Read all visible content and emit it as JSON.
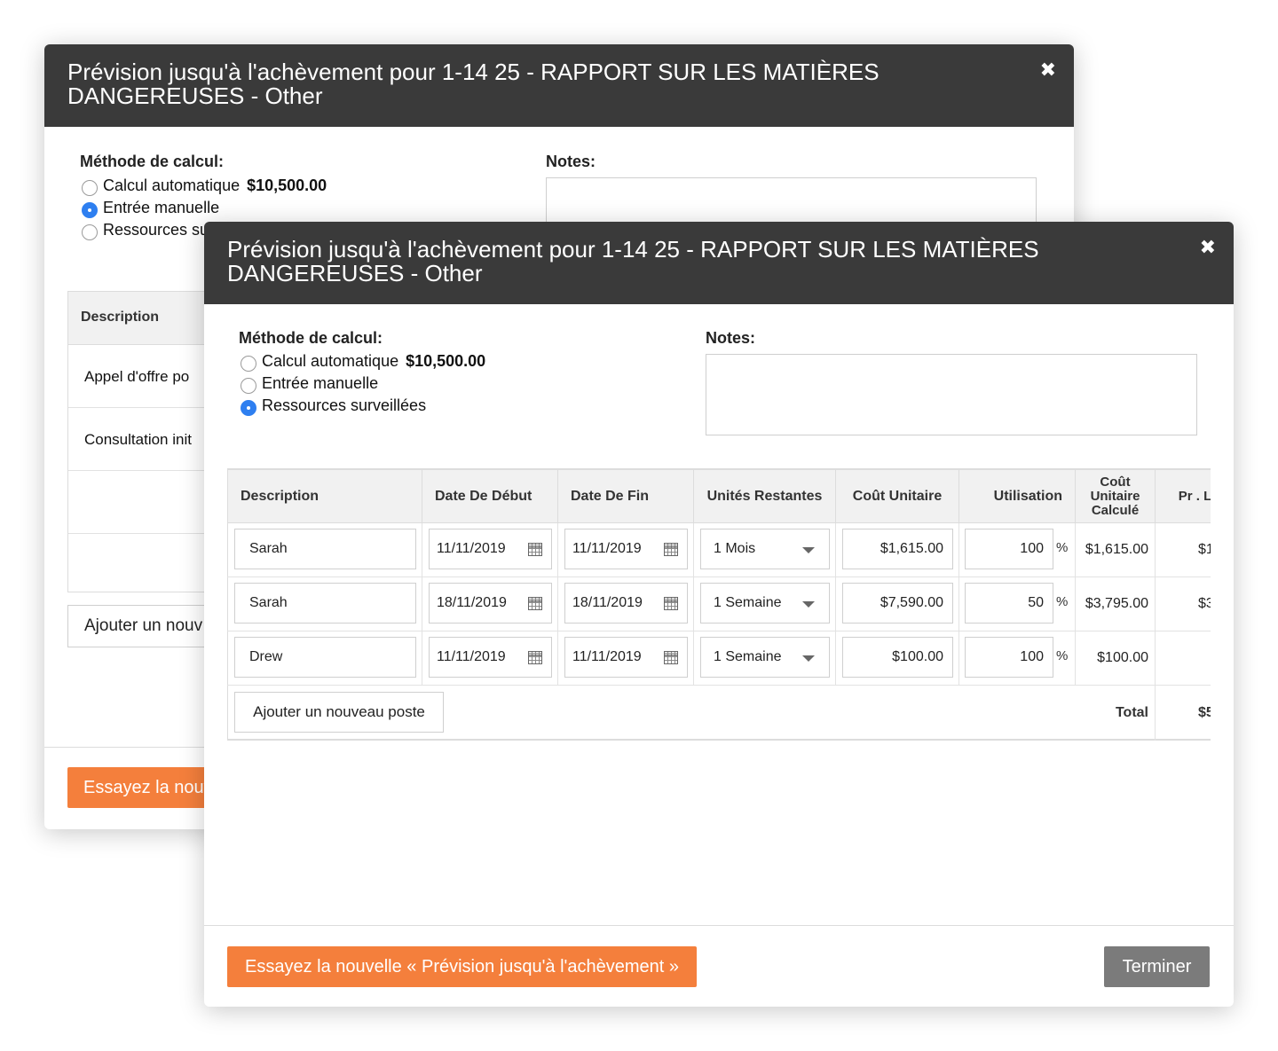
{
  "dialog": {
    "title": "Prévision jusqu'à l'achèvement pour 1-14 25 - RAPPORT SUR LES MATIÈRES DANGEREUSES - Other",
    "close_glyph": "✖",
    "method_label": "Méthode de calcul:",
    "notes_label": "Notes:",
    "options": {
      "auto": "Calcul automatique",
      "auto_amount": "$10,500.00",
      "manual": "Entrée manuelle",
      "tracked": "Ressources surveillées"
    }
  },
  "back_dialog": {
    "options": {
      "manual": "Entrée manuelle",
      "tracked": "Ressources su"
    },
    "table": {
      "header": "Description",
      "rows": [
        "Appel d'offre po",
        "Consultation init",
        "",
        ""
      ]
    },
    "add_button": "Ajouter un nouv",
    "try_button": "Essayez la nouv"
  },
  "table": {
    "headers": {
      "description": "Description",
      "start": "Date De Début",
      "end": "Date De Fin",
      "units": "Unités Restantes",
      "unit_cost": "Coût Unitaire",
      "usage": "Utilisation",
      "calc_cost": "Coût Unitaire Calculé",
      "forecast": "Pr . L'achè"
    },
    "rows": [
      {
        "desc": "Sarah",
        "start": "11/11/2019",
        "end": "11/11/2019",
        "units": "1 Mois",
        "unit_cost": "$1,615.00",
        "usage": "100",
        "pct": "%",
        "calc": "$1,615.00",
        "forecast": "$1"
      },
      {
        "desc": "Sarah",
        "start": "18/11/2019",
        "end": "18/11/2019",
        "units": "1 Semaine",
        "unit_cost": "$7,590.00",
        "usage": "50",
        "pct": "%",
        "calc": "$3,795.00",
        "forecast": "$3"
      },
      {
        "desc": "Drew",
        "start": "11/11/2019",
        "end": "11/11/2019",
        "units": "1 Semaine",
        "unit_cost": "$100.00",
        "usage": "100",
        "pct": "%",
        "calc": "$100.00",
        "forecast": ""
      }
    ],
    "add_button": "Ajouter un nouveau poste",
    "total_label": "Total",
    "total_value": "$5"
  },
  "footer": {
    "try_button": "Essayez la nouvelle « Prévision jusqu'à l'achèvement »",
    "done_button": "Terminer"
  },
  "colors": {
    "header_bg": "#3a3a3a",
    "accent_orange": "#f47f3c",
    "radio_blue": "#2e7ff0",
    "done_grey": "#7b7b7b"
  }
}
